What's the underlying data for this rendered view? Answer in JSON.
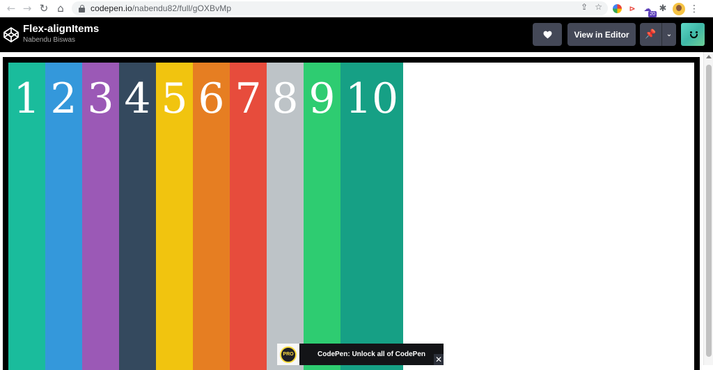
{
  "browser": {
    "url_domain": "codepen.io",
    "url_path": "/nabendu82/full/gOXBvMp",
    "extension_badge": "20",
    "back_icon": "arrow-left-icon",
    "forward_icon": "arrow-right-icon",
    "reload_icon": "reload-icon",
    "home_icon": "home-icon"
  },
  "header": {
    "title": "Flex-alignItems",
    "author": "Nabendu Biswas",
    "view_in_editor_label": "View in Editor",
    "brand_color": "#000000",
    "button_color": "#444857"
  },
  "flex_items": [
    {
      "label": "1",
      "color": "#1abc9c"
    },
    {
      "label": "2",
      "color": "#3498db"
    },
    {
      "label": "3",
      "color": "#9b59b6"
    },
    {
      "label": "4",
      "color": "#34495e"
    },
    {
      "label": "5",
      "color": "#f1c40f"
    },
    {
      "label": "6",
      "color": "#e67e22"
    },
    {
      "label": "7",
      "color": "#e74c3c"
    },
    {
      "label": "8",
      "color": "#bdc3c7"
    },
    {
      "label": "9",
      "color": "#2ecc71"
    },
    {
      "label": "10",
      "color": "#16a085"
    }
  ],
  "promo": {
    "badge": "PRO",
    "text": "CodePen: Unlock all of CodePen",
    "close": "✕"
  }
}
